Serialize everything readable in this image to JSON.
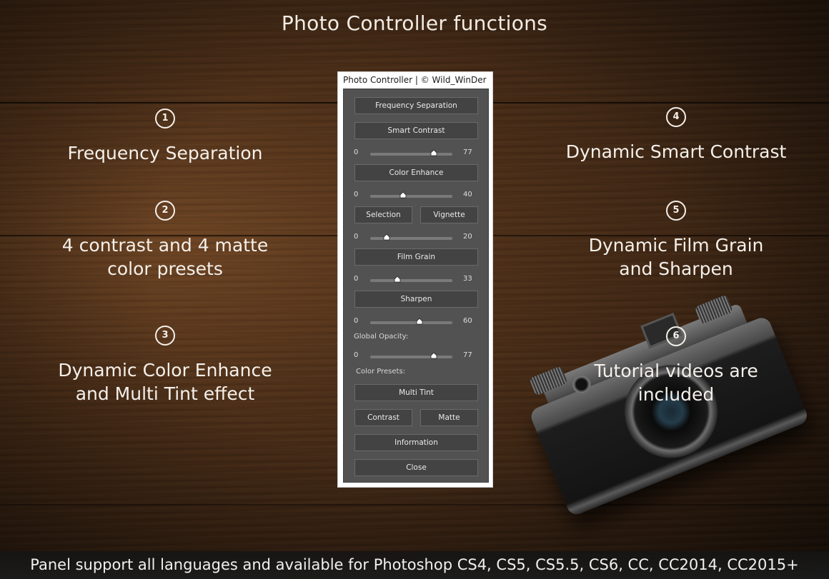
{
  "page": {
    "title": "Photo Controller functions",
    "footer": "Panel support all languages and available for Photoshop CS4, CS5, CS5.5, CS6, CC, CC2014, CC2015+"
  },
  "features": [
    {
      "number": "1",
      "lines": [
        "Frequency Separation"
      ]
    },
    {
      "number": "2",
      "lines": [
        "4 contrast and 4 matte",
        "color presets"
      ]
    },
    {
      "number": "3",
      "lines": [
        "Dynamic Color Enhance",
        "and Multi Tint effect"
      ]
    },
    {
      "number": "4",
      "lines": [
        "Dynamic Smart Contrast"
      ]
    },
    {
      "number": "5",
      "lines": [
        "Dynamic Film Grain",
        "and Sharpen"
      ]
    },
    {
      "number": "6",
      "lines": [
        "Tutorial videos are",
        "included"
      ]
    }
  ],
  "panel": {
    "title": "Photo Controller | © Wild_WinDer",
    "buttons": {
      "frequency_separation": "Frequency Separation",
      "smart_contrast": "Smart Contrast",
      "color_enhance": "Color Enhance",
      "selection": "Selection",
      "vignette": "Vignette",
      "film_grain": "Film Grain",
      "sharpen": "Sharpen",
      "multi_tint": "Multi Tint",
      "contrast": "Contrast",
      "matte": "Matte",
      "information": "Information",
      "close": "Close"
    },
    "labels": {
      "global_opacity": "Global Opacity:",
      "color_presets": "Color Presets:"
    },
    "sliders": {
      "smart_contrast": {
        "min": "0",
        "value": 77,
        "max_display": "77",
        "range_max": 100
      },
      "color_enhance": {
        "min": "0",
        "value": 40,
        "max_display": "40",
        "range_max": 100
      },
      "vignette": {
        "min": "0",
        "value": 20,
        "max_display": "20",
        "range_max": 100
      },
      "film_grain": {
        "min": "0",
        "value": 33,
        "max_display": "33",
        "range_max": 100
      },
      "sharpen": {
        "min": "0",
        "value": 60,
        "max_display": "60",
        "range_max": 100
      },
      "global_opacity": {
        "min": "0",
        "value": 77,
        "max_display": "77",
        "range_max": 100
      }
    }
  },
  "colors": {
    "panel_bg": "#525252",
    "button_bg": "#434343",
    "button_border": "#6a6a6a",
    "text_light": "#f5f0ea",
    "wood": "#4a2d17"
  }
}
